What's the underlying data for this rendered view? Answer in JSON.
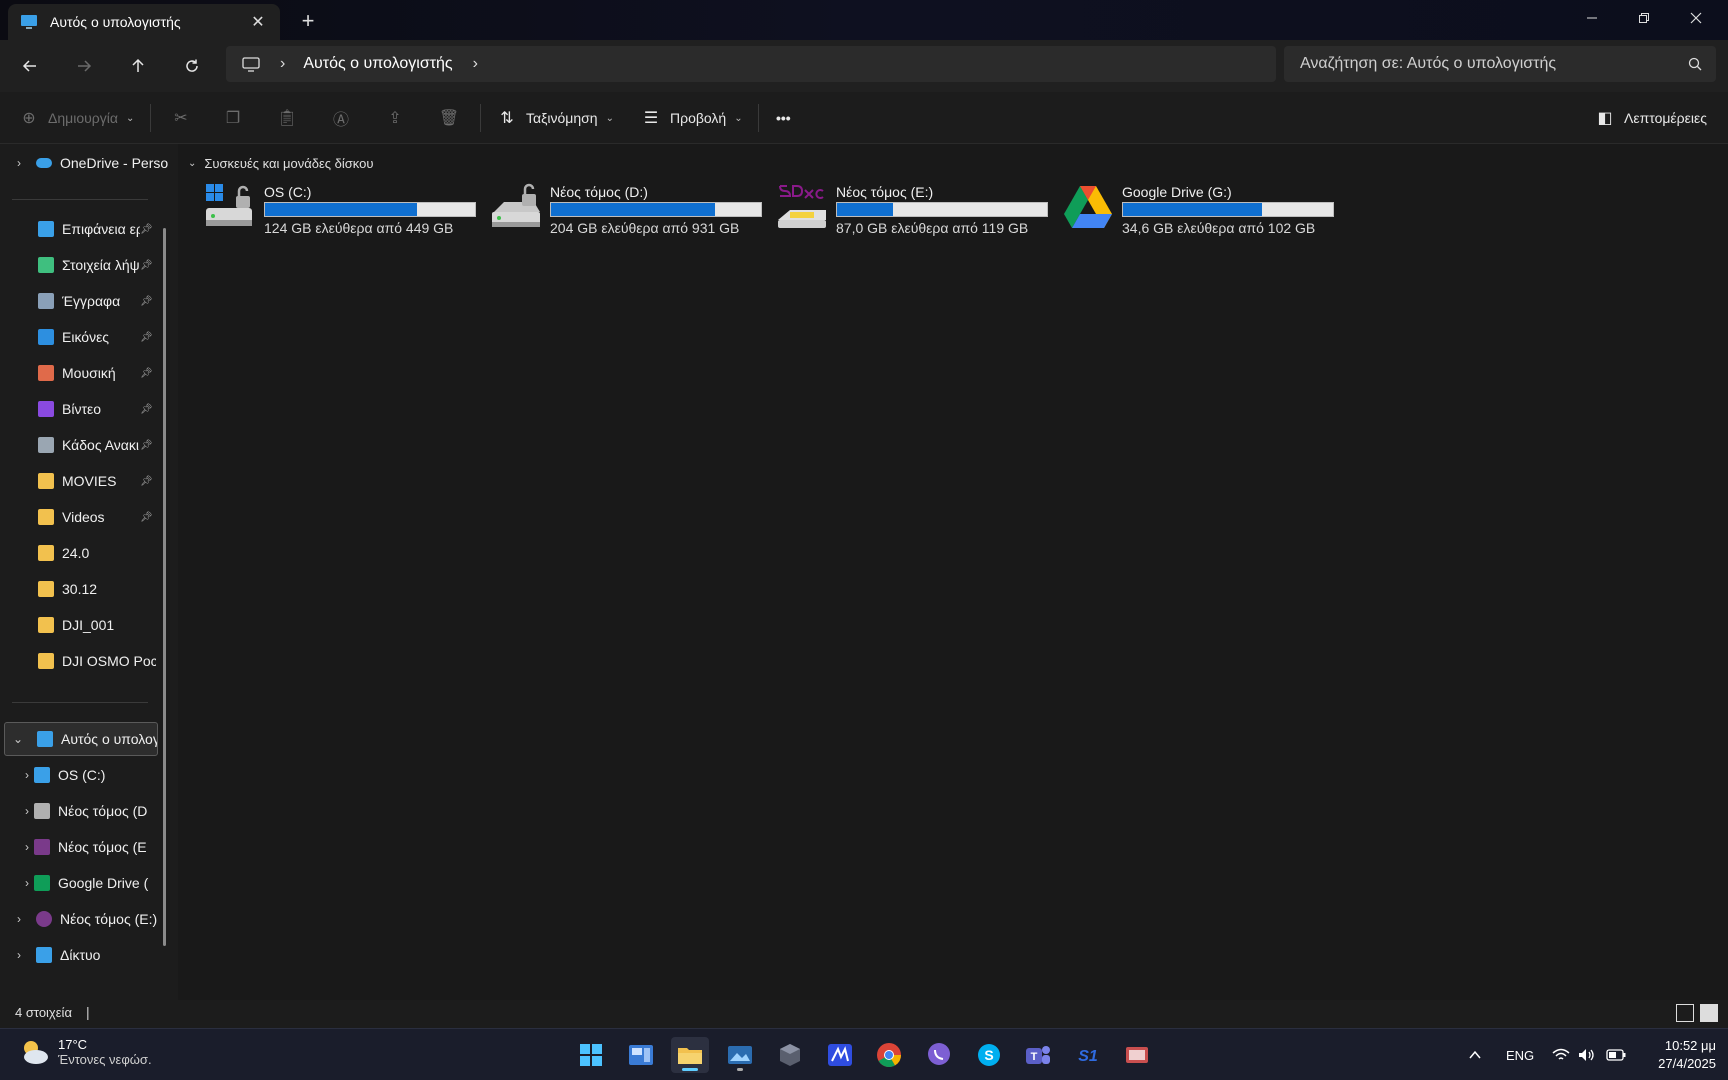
{
  "window": {
    "tab_title": "Αυτός ο υπολογιστής",
    "new_tab_symbol": "+",
    "close_tab_symbol": "✕"
  },
  "address": {
    "breadcrumb": "Αυτός ο υπολογιστής",
    "search_placeholder": "Αναζήτηση σε: Αυτός ο υπολογιστής"
  },
  "toolbar": {
    "new_label": "Δημιουργία",
    "sort_label": "Ταξινόμηση",
    "view_label": "Προβολή",
    "more_label": "•••",
    "details_label": "Λεπτομέρειες"
  },
  "sidebar": {
    "onedrive": "OneDrive - Perso",
    "pinned": [
      {
        "label": "Επιφάνεια ερ",
        "color": "#3aa0e8"
      },
      {
        "label": "Στοιχεία λήψ",
        "color": "#3fbf7f"
      },
      {
        "label": "Έγγραφα",
        "color": "#8aa0b8"
      },
      {
        "label": "Εικόνες",
        "color": "#2d8fe0"
      },
      {
        "label": "Μουσική",
        "color": "#e06a4a"
      },
      {
        "label": "Βίντεο",
        "color": "#8a4ae0"
      },
      {
        "label": "Κάδος Ανακι",
        "color": "#9aa6b2"
      },
      {
        "label": "MOVIES",
        "color": "#f2c14e"
      },
      {
        "label": "Videos",
        "color": "#f2c14e"
      },
      {
        "label": "24.0",
        "color": "#f2c14e"
      },
      {
        "label": "30.12",
        "color": "#f2c14e"
      },
      {
        "label": "DJI_001",
        "color": "#f2c14e"
      },
      {
        "label": "DJI OSMO Pocke",
        "color": "#f2c14e"
      }
    ],
    "this_pc": "Αυτός ο υπολογ",
    "drives": [
      {
        "label": "OS (C:)"
      },
      {
        "label": "Νέος τόμος (D"
      },
      {
        "label": "Νέος τόμος (E"
      },
      {
        "label": "Google Drive ("
      }
    ],
    "removable": "Νέος τόμος (E:)",
    "network": "Δίκτυο"
  },
  "content": {
    "group_title": "Συσκευές και μονάδες δίσκου",
    "drives": [
      {
        "name": "OS (C:)",
        "free_text": "124 GB ελεύθερα από 449 GB",
        "used_fraction": 0.724,
        "icon": "windows-drive-icon"
      },
      {
        "name": "Νέος τόμος (D:)",
        "free_text": "204 GB ελεύθερα από 931 GB",
        "used_fraction": 0.781,
        "icon": "hard-drive-icon"
      },
      {
        "name": "Νέος τόμος (E:)",
        "free_text": "87,0 GB ελεύθερα από 119 GB",
        "used_fraction": 0.269,
        "icon": "sdxc-card-icon"
      },
      {
        "name": "Google Drive (G:)",
        "free_text": "34,6 GB ελεύθερα από 102 GB",
        "used_fraction": 0.661,
        "icon": "google-drive-icon"
      }
    ]
  },
  "status": {
    "item_count": "4 στοιχεία"
  },
  "taskbar": {
    "temperature": "17°C",
    "weather_desc": "Έντονες νεφώσ.",
    "language": "ENG",
    "time": "10:52 μμ",
    "date": "27/4/2025",
    "app_label_s1": "S1"
  },
  "colors": {
    "accent": "#0f6fd0",
    "background": "#191919",
    "panel": "#202020"
  }
}
